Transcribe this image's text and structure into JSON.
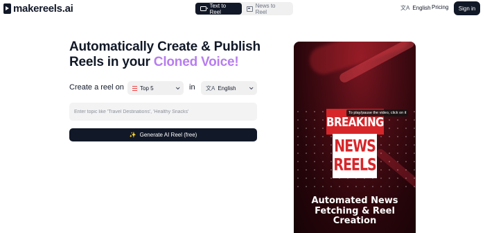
{
  "header": {
    "logo_text": "makereels.ai",
    "tabs": [
      {
        "label": "Text to Reel",
        "active": true
      },
      {
        "label": "News to Reel",
        "active": false
      }
    ],
    "language_label": "English",
    "pricing_label": "Pricing",
    "signin_label": "Sign in"
  },
  "hero": {
    "title_part1": "Automatically Create & Publish",
    "title_part2": "Reels in your ",
    "title_accent": "Cloned Voice!",
    "accent_color": "#b77df0"
  },
  "form": {
    "create_label": "Create a reel on",
    "format_value": "Top 5",
    "in_label": "in",
    "language_value": "English",
    "topic_placeholder": "Enter topic like 'Travel Destinations', 'Healthy Snacks'",
    "topic_value": "",
    "generate_label": "Generate AI Reel (free)"
  },
  "video": {
    "tooltip": "To play/pause the video, click on it",
    "breaking": "BREAKING",
    "news_line1": "NEWS",
    "news_line2": "REELS",
    "caption": "Automated News Fetching & Reel Creation"
  },
  "icons": {
    "logo": "play-logo-icon",
    "text_to_reel": "camera-icon",
    "news_to_reel": "newspaper-icon",
    "language": "translate-icon",
    "format": "list-icon",
    "generate": "magic-wand-icon"
  },
  "colors": {
    "primary_dark": "#111827",
    "accent_purple": "#b77df0",
    "news_red": "#d7262a"
  }
}
